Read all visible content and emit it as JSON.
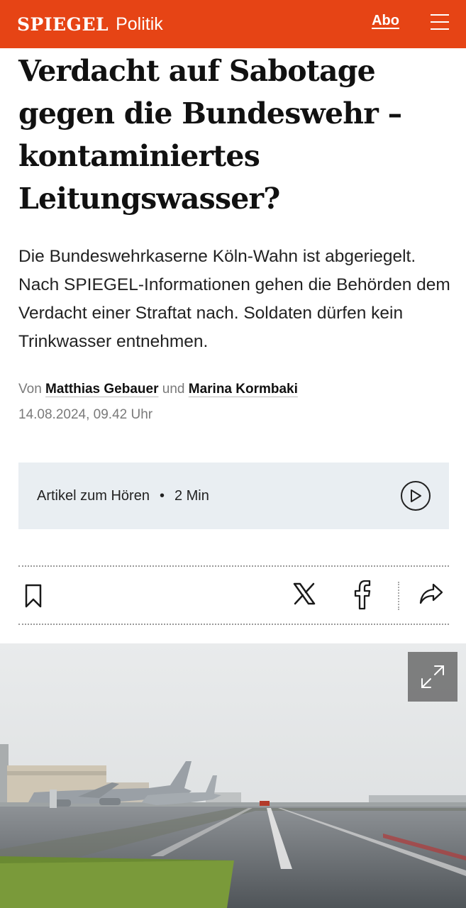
{
  "header": {
    "logo": "SPIEGEL",
    "section": "Politik",
    "abo_label": "Abo"
  },
  "article": {
    "headline": "Verdacht auf Sabotage gegen die Bundeswehr – kontaminiertes Leitungswasser?",
    "lead": "Die Bundeswehrkaserne Köln-Wahn ist abgeriegelt. Nach SPIEGEL-Informationen gehen die Behörden dem Verdacht einer Straftat nach. Soldaten dürfen kein Trinkwasser entnehmen.",
    "byline_prefix": "Von",
    "author1": "Matthias Gebauer",
    "byline_and": "und",
    "author2": "Marina Kormbaki",
    "date": "14.08.2024, 09.42 Uhr"
  },
  "audio": {
    "label": "Artikel zum Hören",
    "separator": "•",
    "duration": "2 Min"
  },
  "icons": {
    "menu": "hamburger-icon",
    "play": "play-icon",
    "bookmark": "bookmark-icon",
    "x": "x-icon",
    "facebook": "facebook-icon",
    "share": "share-icon",
    "expand": "expand-icon"
  },
  "colors": {
    "brand": "#e64415",
    "audio_bg": "#e9eef2"
  }
}
